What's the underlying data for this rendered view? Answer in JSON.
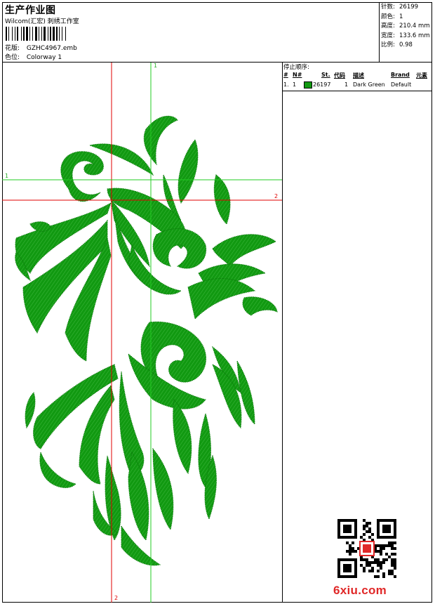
{
  "header": {
    "title": "生产作业图",
    "company": "Wilcom(汇宏) 刺绣工作室",
    "design_label": "花版:",
    "design_value": "GZHC4967.emb",
    "colorway_label": "色位:",
    "colorway_value": "Colorway 1"
  },
  "stats": [
    {
      "label": "针数:",
      "value": "26199"
    },
    {
      "label": "颜色:",
      "value": "1"
    },
    {
      "label": "高度:",
      "value": "210.4 mm"
    },
    {
      "label": "宽度:",
      "value": "133.6 mm"
    },
    {
      "label": "比例:",
      "value": "0.98"
    }
  ],
  "stop_sequence": {
    "label": "停止顺序:",
    "columns": [
      "#",
      "N#",
      "St.",
      "代码",
      "描述",
      "Brand",
      "元素"
    ],
    "rows": [
      {
        "index": "1.",
        "needle": "1",
        "color": "#119911",
        "stitches": "26197",
        "code": "1",
        "description": "Dark Green",
        "brand": "Default"
      }
    ]
  },
  "guides": {
    "green_top": "1",
    "green_left": "1",
    "red_right": "2",
    "red_bottom": "2"
  },
  "colors": {
    "thread": "#119911",
    "guide_red": "#e00000",
    "guide_green": "#22cc22",
    "brand": "#e02828"
  },
  "watermark": "6xiu.com"
}
